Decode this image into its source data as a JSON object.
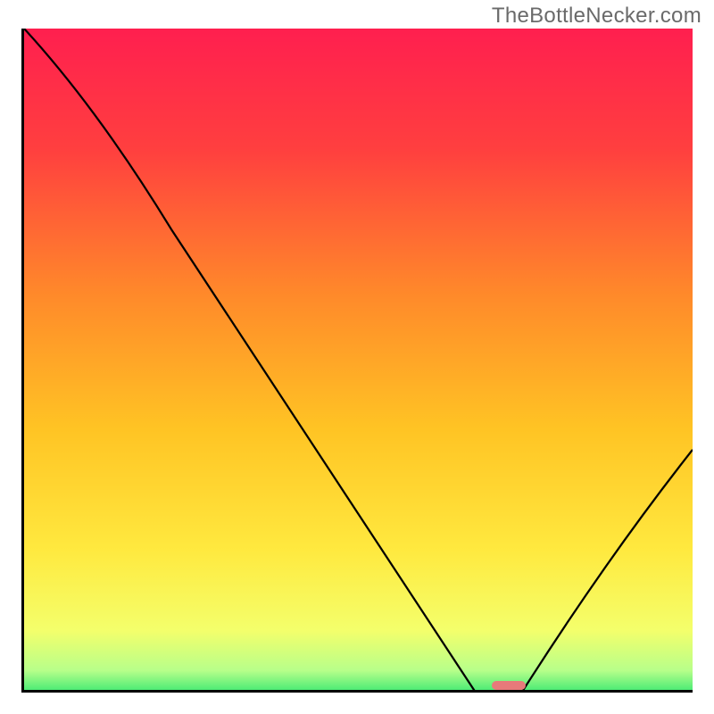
{
  "watermark": "TheBottleNecker.com",
  "chart_data": {
    "type": "line",
    "title": "",
    "xlabel": "",
    "ylabel": "",
    "xlim": [
      0,
      100
    ],
    "ylim": [
      0,
      100
    ],
    "x": [
      0,
      22,
      68,
      74,
      100
    ],
    "values": [
      100,
      70,
      0,
      0,
      37
    ],
    "gradient_stops": [
      {
        "pos": 0.0,
        "color": "#ff1f4f"
      },
      {
        "pos": 0.18,
        "color": "#ff3f3f"
      },
      {
        "pos": 0.4,
        "color": "#ff8a2a"
      },
      {
        "pos": 0.6,
        "color": "#ffc424"
      },
      {
        "pos": 0.78,
        "color": "#ffe93f"
      },
      {
        "pos": 0.9,
        "color": "#f4ff6b"
      },
      {
        "pos": 0.96,
        "color": "#b8ff8a"
      },
      {
        "pos": 1.0,
        "color": "#28e56f"
      }
    ],
    "marker": {
      "start": 70,
      "end": 75,
      "color": "#e77a7a"
    }
  }
}
